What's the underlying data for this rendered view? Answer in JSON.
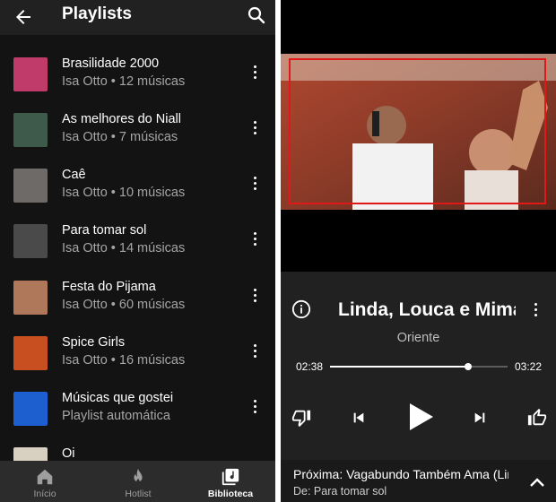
{
  "header": {
    "title": "Playlists",
    "back_icon": "arrow-left-icon",
    "search_icon": "search-icon"
  },
  "playlists": [
    {
      "title": "Brasilidade 2000",
      "subtitle": "Isa Otto • 12 músicas",
      "thumb_color": "#c03a6a"
    },
    {
      "title": "As melhores do Niall",
      "subtitle": "Isa Otto • 7 músicas",
      "thumb_color": "#3e5a4a"
    },
    {
      "title": "Caê",
      "subtitle": "Isa Otto • 10 músicas",
      "thumb_color": "#6e6a68"
    },
    {
      "title": "Para tomar sol",
      "subtitle": "Isa Otto • 14 músicas",
      "thumb_color": "#4a4a4a"
    },
    {
      "title": "Festa do Pijama",
      "subtitle": "Isa Otto • 60 músicas",
      "thumb_color": "#b0785a"
    },
    {
      "title": "Spice Girls",
      "subtitle": "Isa Otto • 16 músicas",
      "thumb_color": "#c85020"
    },
    {
      "title": "Músicas que gostei",
      "subtitle": "Playlist automática",
      "thumb_color": "#1e5fd0"
    },
    {
      "title": "Oi",
      "subtitle": "",
      "thumb_color": "#d8d0c0"
    }
  ],
  "nav": [
    {
      "label": "Início",
      "icon": "home-icon",
      "active": false
    },
    {
      "label": "Hotlist",
      "icon": "flame-icon",
      "active": false
    },
    {
      "label": "Biblioteca",
      "icon": "library-icon",
      "active": true
    }
  ],
  "player": {
    "title": "Linda, Louca e Mimada",
    "artist": "Oriente",
    "time_current": "02:38",
    "time_total": "03:22",
    "progress": 0.78,
    "next_title": "Próxima: Vagabundo Também Ama (Linda, Louca e Mimada)",
    "next_source": "De: Para tomar sol",
    "highlight_color": "#e01818"
  }
}
